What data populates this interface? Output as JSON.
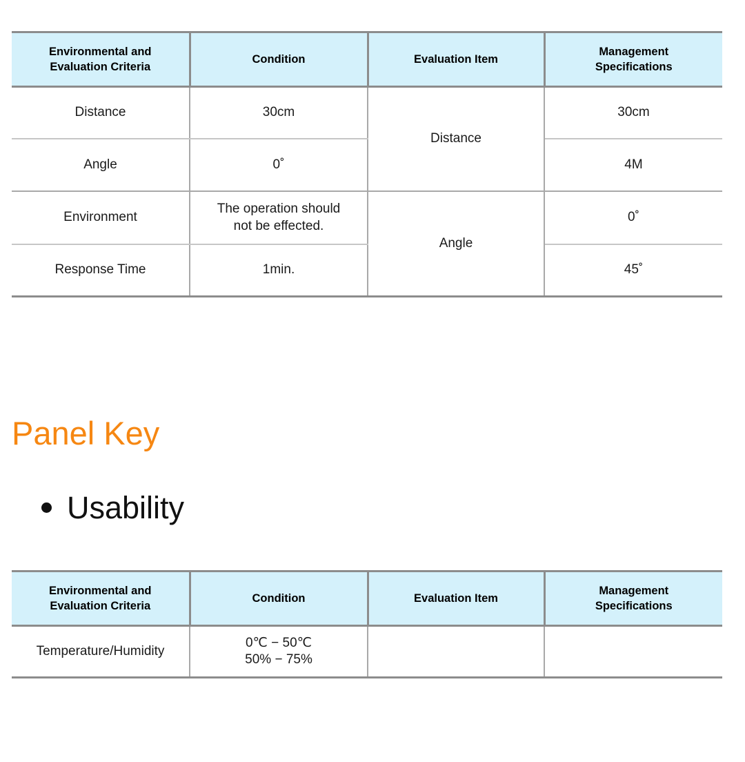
{
  "theme": {
    "header_bg": "#d4f1fb",
    "header_border": "#8c8c8c",
    "row_divider": "#c6c6c6",
    "accent_heading": "#f68712",
    "text": "#1a1a1a"
  },
  "table_one": {
    "columns": [
      "Environmental and\nEvaluation Criteria",
      "Condition",
      "Evaluation Item",
      "Management\nSpecifications"
    ],
    "headers": {
      "criteria_line1": "Environmental and",
      "criteria_line2": "Evaluation Criteria",
      "condition": "Condition",
      "evaluation_item": "Evaluation Item",
      "management_line1": "Management",
      "management_line2": "Specifications"
    },
    "rows": [
      {
        "criteria": "Distance",
        "condition": "30cm",
        "evaluation_item": "Distance",
        "evaluation_item_rowspan": 2,
        "management": "30cm"
      },
      {
        "criteria": "Angle",
        "condition": "0˚",
        "management": "4M"
      },
      {
        "criteria": "Environment",
        "condition_line1": "The operation should",
        "condition_line2": "not be effected.",
        "evaluation_item": "Angle",
        "evaluation_item_rowspan": 2,
        "management": "0˚"
      },
      {
        "criteria": "Response Time",
        "condition": "1min.",
        "management": "45˚"
      }
    ]
  },
  "panel_key": {
    "title": "Panel Key",
    "bullets": [
      {
        "label": "Usability"
      }
    ]
  },
  "table_two": {
    "headers": {
      "criteria_line1": "Environmental and",
      "criteria_line2": "Evaluation Criteria",
      "condition": "Condition",
      "evaluation_item": "Evaluation Item",
      "management_line1": "Management",
      "management_line2": "Specifications"
    },
    "rows": [
      {
        "criteria": "Temperature/Humidity",
        "condition_line1": "0℃ − 50℃",
        "condition_line2": "50% − 75%",
        "evaluation_item": "",
        "management": ""
      }
    ]
  }
}
